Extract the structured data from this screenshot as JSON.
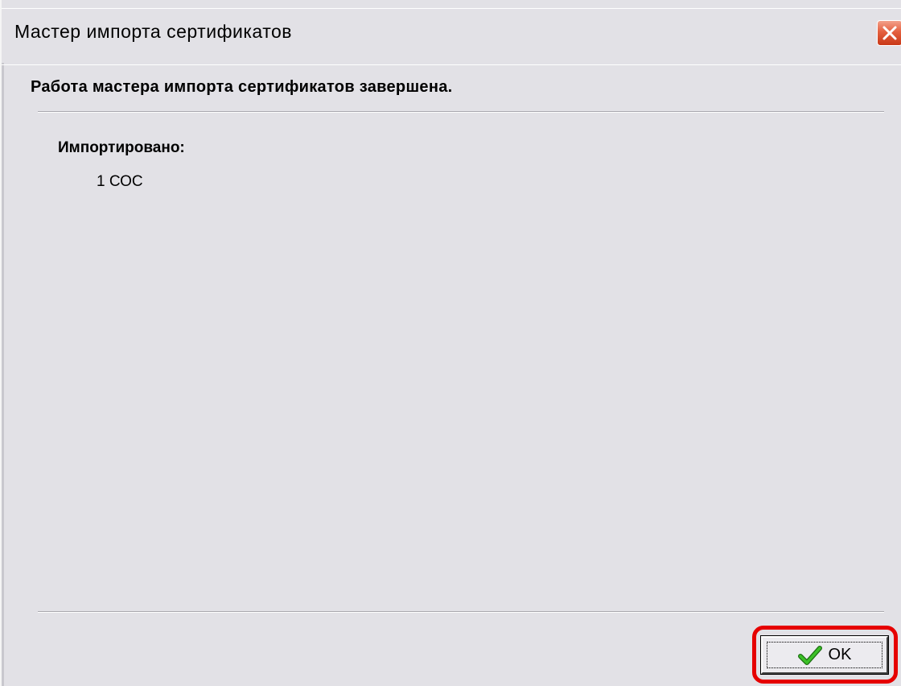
{
  "window": {
    "title": "Мастер импорта сертификатов"
  },
  "main": {
    "headline": "Работа мастера импорта сертификатов завершена.",
    "imported_label": "Импортировано:",
    "imported_value": "1 СОС"
  },
  "footer": {
    "ok_label": "OK"
  },
  "icons": {
    "close": "close-icon",
    "ok": "checkmark-icon"
  },
  "colors": {
    "dialog_background": "#e2e1e6",
    "close_button": "#e4603f",
    "highlight": "#e60000",
    "checkmark": "#2e9a1e"
  }
}
